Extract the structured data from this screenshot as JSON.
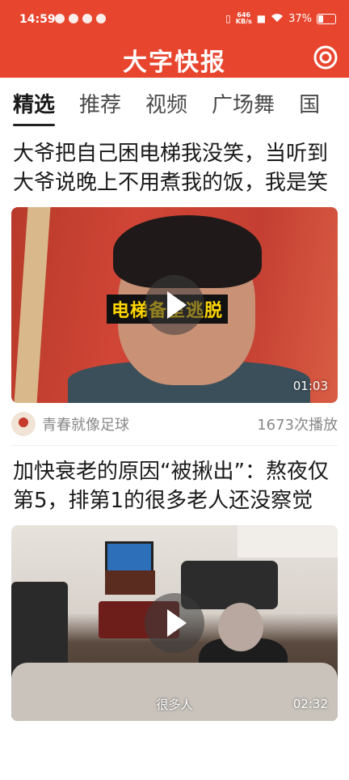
{
  "status_bar": {
    "time": "14:59",
    "net_speed_value": "646",
    "net_speed_unit": "KB/s",
    "battery": "37%",
    "battery_level": 0.37
  },
  "app": {
    "title": "大字快报",
    "accent_color": "#e8452e"
  },
  "tabs": [
    {
      "label": "精选",
      "active": true
    },
    {
      "label": "推荐",
      "active": false
    },
    {
      "label": "视频",
      "active": false
    },
    {
      "label": "广场舞",
      "active": false
    },
    {
      "label": "国",
      "active": false
    }
  ],
  "articles": [
    {
      "title": "大爷把自己困电梯我没笑，当听到大爷说晚上不用煮我的饭，我是笑",
      "video_caption": "电梯备室逃脱",
      "duration": "01:03",
      "author": "青春就像足球",
      "plays": "1673次播放"
    },
    {
      "title": "加快衰老的原因“被揪出”：熬夜仅第5，排第1的很多老人还没察觉",
      "video_caption": "很多人",
      "duration": "02:32"
    }
  ]
}
